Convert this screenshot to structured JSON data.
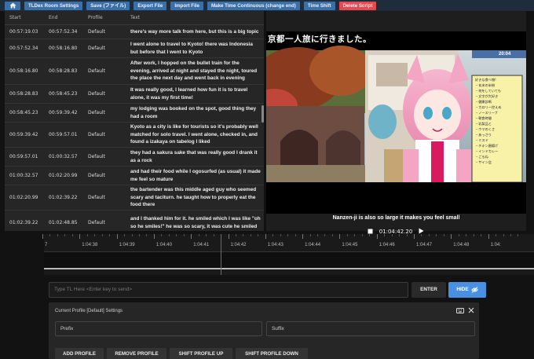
{
  "toolbar": {
    "home_icon": "home-icon",
    "buttons": [
      {
        "label": "TLDex Room Settings"
      },
      {
        "label": "Save (ファイル)"
      },
      {
        "label": "Export File"
      },
      {
        "label": "Import File"
      },
      {
        "label": "Make Time Continuous (change end)"
      },
      {
        "label": "Time Shift"
      },
      {
        "label": "Delete Script"
      }
    ],
    "danger_color": "#e64a4f",
    "button_color": "#3b6fa8"
  },
  "table": {
    "headers": {
      "start": "Start",
      "end": "End",
      "profile": "Profile",
      "text": "Text"
    },
    "rows": [
      {
        "start": "00:57:19.03",
        "end": "00:57:52.34",
        "profile": "Default",
        "text": "there's way more talk from here, but this is a big topic"
      },
      {
        "start": "00:57:52.34",
        "end": "00:58:16.80",
        "profile": "Default",
        "text": "I went alone to travel to Kyoto! there was Indonesia but before that I went to Kyoto"
      },
      {
        "start": "00:58:16.80",
        "end": "00:58:28.83",
        "profile": "Default",
        "text": "After work, I hopped on the bullet train for the evening, arrived at night and stayed the night, toured the place the next day and went back in evening"
      },
      {
        "start": "00:58:28.83",
        "end": "00:58:45.23",
        "profile": "Default",
        "text": "It was really good, I learned how fun it is to travel alone, it was my first time!"
      },
      {
        "start": "00:58:45.23",
        "end": "00:59:39.42",
        "profile": "Default",
        "text": "my lodging was booked on the spot, good thing they had a room"
      },
      {
        "start": "00:59:39.42",
        "end": "00:59:57.01",
        "profile": "Default",
        "text": "Kyoto as a city is like for tourists so it's probably well matched for solo travel. I went alone, checked in, and found a izakaya on tabelog I liked"
      },
      {
        "start": "00:59:57.01",
        "end": "01:00:32.57",
        "profile": "Default",
        "text": "they had a sakura sake that was really good I drank it as a rock"
      },
      {
        "start": "01:00:32.57",
        "end": "01:02:20.99",
        "profile": "Default",
        "text": "and had their food while I ogosurfed (as usual) it made me feel so mature"
      },
      {
        "start": "01:02:20.99",
        "end": "01:02:39.22",
        "profile": "Default",
        "text": "the bartender was this middle aged guy who seemed scary and taciturn. he taught how to properly eat the food there"
      },
      {
        "start": "01:02:39.22",
        "end": "01:02:48.85",
        "profile": "Default",
        "text": "and I thanked him for it. he smiled which I was like \"oh so he smiles!\" he was so scary, it was cute he smiled"
      }
    ]
  },
  "video": {
    "overlay_title": "京都一人旅に行きました。",
    "overlay_time": "20:04",
    "sign_lines": [
      "好きな食べ物!",
      "・玄米の米粉",
      "・何をしていても",
      "・文字が大好き",
      "・健康診断",
      "・カロリー控えめ",
      "・ノースリーブ",
      "・朝食時間",
      "・乳製品と",
      "・ウマのくさ",
      "・あっさり",
      "・ミスド",
      "・チキン唐揚げ",
      "・インドカレー",
      "・ごろね",
      "・サイン会"
    ],
    "caption": "Nanzen-ji is also so large it makes you feel small",
    "timecode": "01:04:42.20",
    "stop_icon": "stop-icon",
    "play_icon": "play-icon"
  },
  "timeline": {
    "labels": [
      "7",
      "1:04:38",
      "1:04:39",
      "1:04:40",
      "1:04:41",
      "1:04:42",
      "1:04:43",
      "1:04:44",
      "1:04:45",
      "1:04:46",
      "1:04:47",
      "1:04:48",
      "1:04:"
    ],
    "playhead_color": "#e53935"
  },
  "input": {
    "placeholder": "Type TL Here <Enter key to send>",
    "enter_label": "ENTER",
    "hide_label": "HIDE",
    "hide_color": "#4a90e2"
  },
  "settings": {
    "title": "Current Profile [Default] Settings",
    "prefix_placeholder": "Prefix",
    "suffix_placeholder": "Suffix",
    "buttons": [
      "ADD PROFILE",
      "REMOVE PROFILE",
      "SHIFT PROFILE UP",
      "SHIFT PROFILE DOWN"
    ]
  }
}
